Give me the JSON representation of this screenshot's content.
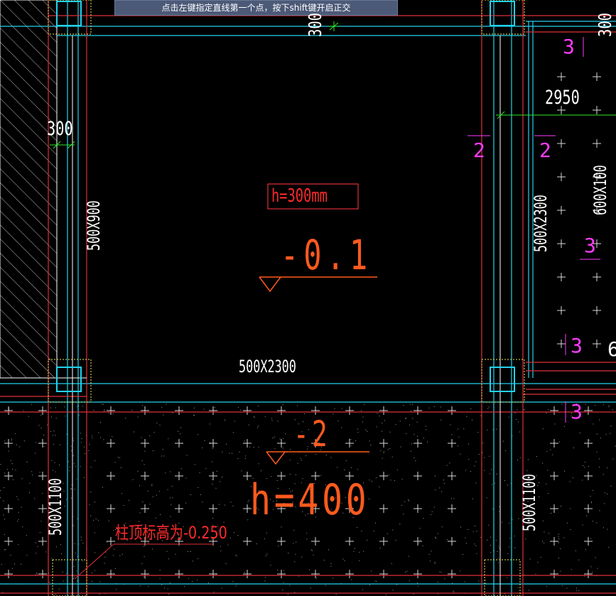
{
  "status_tip": "点击左键指定直线第一个点，按下shift键开启正交",
  "dims": {
    "top_300": "300",
    "right_300": "300",
    "left_300": "300",
    "dim_2950": "2950"
  },
  "beams": {
    "left_upper": "500X900",
    "middle_horizontal": "500X2300",
    "right_vertical": "500X2300",
    "right_edge": "600X100",
    "left_lower": "500X1100",
    "right_lower": "500X1100"
  },
  "slab_top": {
    "thickness": "h=300mm",
    "elevation": "-0.1"
  },
  "slab_bottom": {
    "elevation": "-2",
    "thickness": "h=400"
  },
  "marks": {
    "m3_top": "3",
    "m2_left": "2",
    "m2_right": "2",
    "m3_mid": "3",
    "m3_lower": "3",
    "m3_bottom": "3",
    "m6_edge": "6"
  },
  "column_note": "柱顶标高为-0.250",
  "colors": {
    "beam_line": "#22d3ee",
    "red_line": "#e0303a",
    "white_line": "#ffffff",
    "magenta_text": "#ff3cff",
    "orange_text": "#ff5a1e",
    "yellow_dashed": "#e8e85a",
    "green_dim": "#2ee82e"
  }
}
